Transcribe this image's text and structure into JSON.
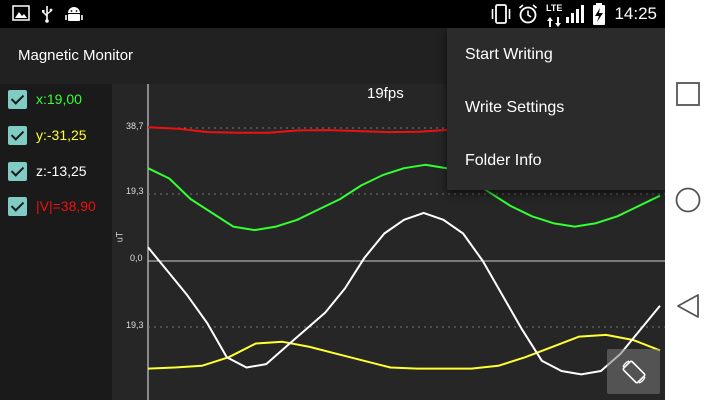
{
  "status_bar": {
    "time": "14:25",
    "network": "LTE",
    "icons": [
      "image-icon",
      "usb-icon",
      "android-debug-icon",
      "vibrate-icon",
      "alarm-icon",
      "signal-icon",
      "battery-charging-icon"
    ]
  },
  "app": {
    "title": "Magnetic Monitor"
  },
  "axes": [
    {
      "label": "x:19,00",
      "color": "#33ff33",
      "checked": true
    },
    {
      "label": "y:-31,25",
      "color": "#ffff33",
      "checked": true
    },
    {
      "label": "z:-13,25",
      "color": "#ffffff",
      "checked": true
    },
    {
      "label": "|V|=38,90",
      "color": "#ee1111",
      "checked": true
    }
  ],
  "menu": {
    "items": [
      "Start Writing",
      "Write Settings",
      "Folder Info"
    ]
  },
  "chart": {
    "fps": "19fps",
    "unit": "uT"
  },
  "chart_data": {
    "type": "line",
    "title": "",
    "xlabel": "",
    "ylabel": "uT",
    "y_ticks": [
      "38,7",
      "19,3",
      "0,0",
      "19,3"
    ],
    "grid": true,
    "series": [
      {
        "name": "|V|",
        "color": "#ee1111",
        "values": [
          38.9,
          38.5,
          37.5,
          37.3,
          37.3,
          38.0,
          38.1,
          37.8,
          37.5,
          37.6,
          38.2,
          39.0,
          39.5,
          40.0,
          39.8,
          39.3,
          39.0,
          38.9
        ]
      },
      {
        "name": "x",
        "color": "#33ff33",
        "values": [
          27,
          24,
          18,
          14,
          10,
          9,
          10,
          12,
          15,
          18,
          22,
          25,
          27,
          28,
          27,
          24,
          20,
          16,
          13,
          11,
          10,
          11,
          13,
          16,
          19
        ]
      },
      {
        "name": "y",
        "color": "#ffff33",
        "values": [
          -31.3,
          -31.0,
          -30.5,
          -28,
          -24,
          -23.5,
          -25,
          -27,
          -29,
          -31,
          -31.3,
          -31.3,
          -31.3,
          -30.5,
          -28,
          -25,
          -22,
          -21.5,
          -23,
          -26
        ]
      },
      {
        "name": "z",
        "color": "#ffffff",
        "values": [
          4,
          -3,
          -10,
          -18,
          -28,
          -31,
          -30,
          -25,
          -20,
          -15,
          -8,
          1,
          8,
          12,
          14,
          12,
          8,
          0,
          -10,
          -20,
          -29,
          -32,
          -33,
          -32,
          -27,
          -20,
          -13
        ]
      }
    ]
  },
  "nav": {
    "buttons": [
      "recents-square-icon",
      "home-circle-icon",
      "back-triangle-icon"
    ]
  }
}
